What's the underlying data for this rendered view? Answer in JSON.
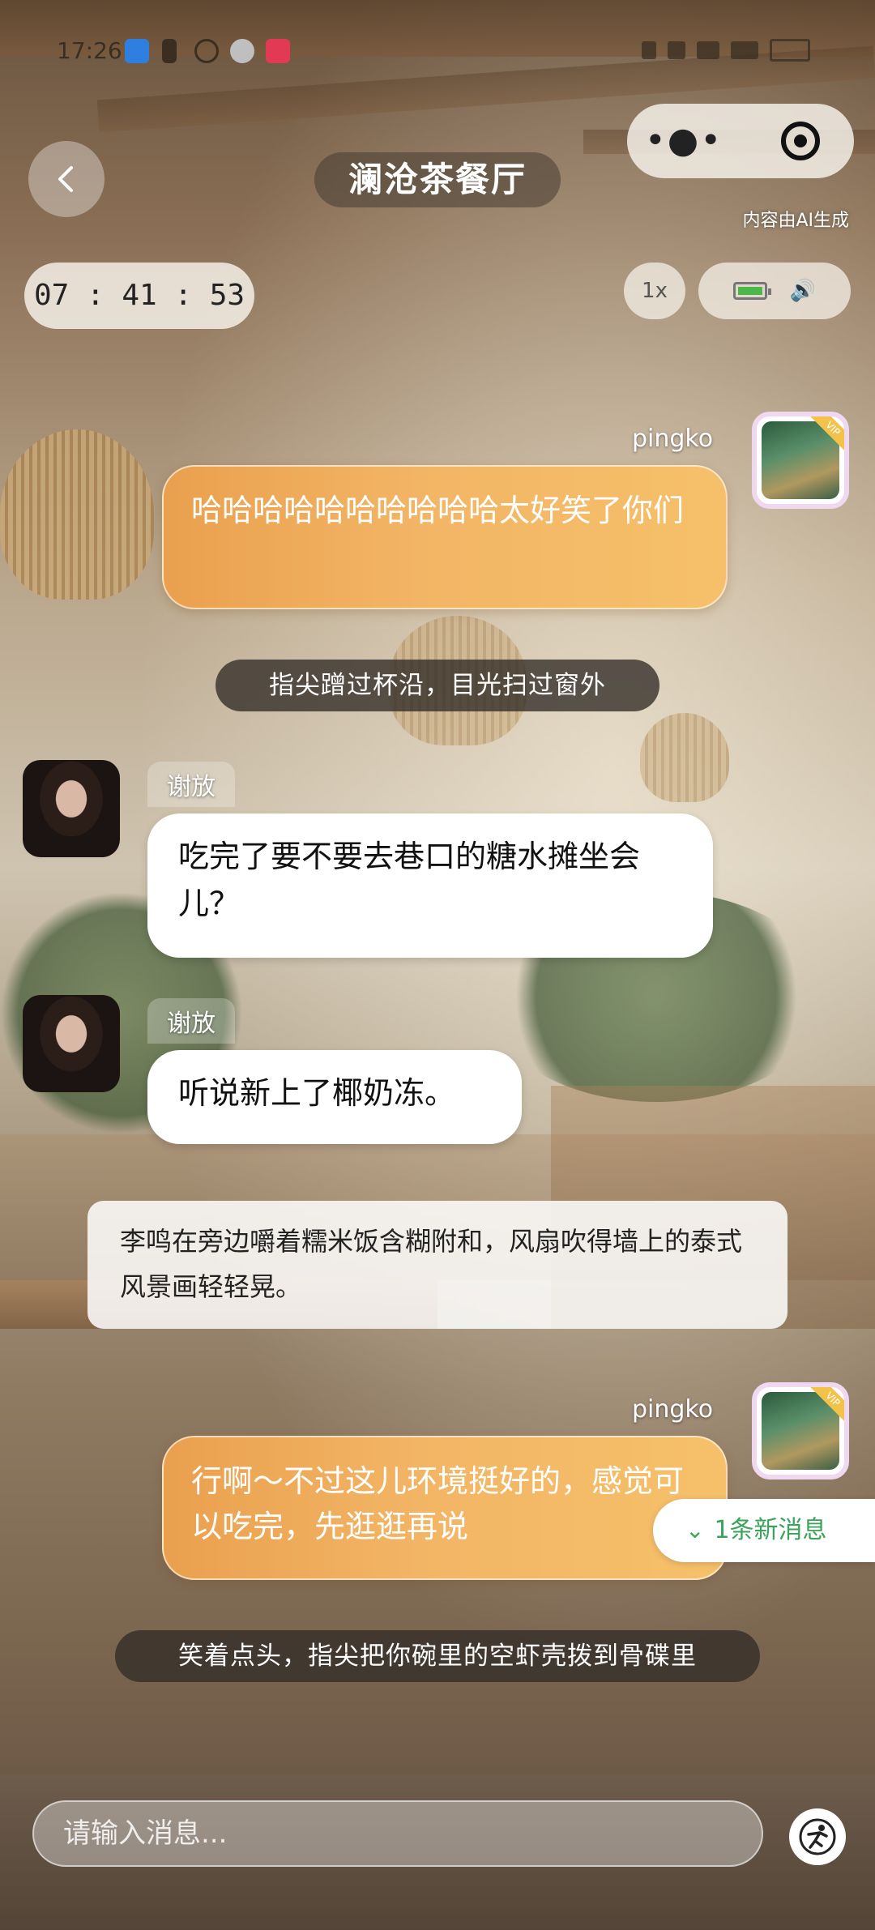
{
  "status_bar": {
    "time": "17:26"
  },
  "header": {
    "title": "澜沧茶餐厅",
    "more_icon": "more-dots-icon",
    "close_icon": "target-close-icon",
    "ai_note": "内容由AI生成"
  },
  "timer": {
    "text": "07 : 41 : 53"
  },
  "speed": {
    "label": "1x"
  },
  "messages": [
    {
      "type": "user",
      "name": "pingko",
      "text": "哈哈哈哈哈哈哈哈哈哈太好笑了你们"
    },
    {
      "type": "narration",
      "text": "指尖蹭过杯沿，目光扫过窗外"
    },
    {
      "type": "npc",
      "name": "谢放",
      "text": "吃完了要不要去巷口的糖水摊坐会儿？"
    },
    {
      "type": "npc",
      "name": "谢放",
      "text": "听说新上了椰奶冻。"
    },
    {
      "type": "narration_box",
      "text": "李鸣在旁边嚼着糯米饭含糊附和，风扇吹得墙上的泰式风景画轻轻晃。"
    },
    {
      "type": "user",
      "name": "pingko",
      "text": "行啊～不过这儿环境挺好的，感觉可以吃完，先逛逛再说"
    },
    {
      "type": "narration",
      "text": "笑着点头，指尖把你碗里的空虾壳拨到骨碟里"
    }
  ],
  "new_message_tip": "1条新消息",
  "input": {
    "placeholder": "请输入消息..."
  },
  "colors": {
    "user_bubble": "#f2b565",
    "new_msg": "#3aa35a"
  }
}
